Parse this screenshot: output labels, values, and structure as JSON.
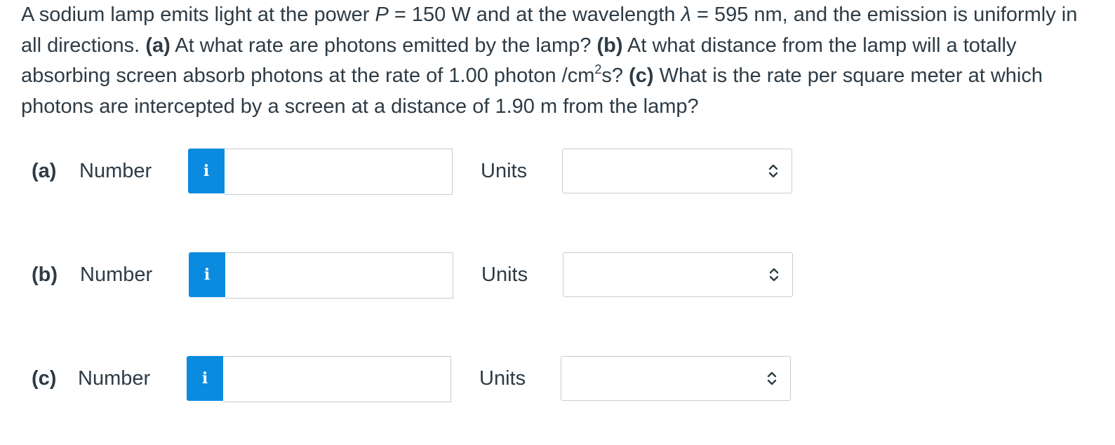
{
  "question": {
    "intro": "A sodium lamp emits light at the power ",
    "P_sym": "P",
    "P_val": " = 150 W and at the wavelength ",
    "lambda_sym": "λ",
    "lambda_val": " = 595 nm, and the emission is uniformly in all directions. ",
    "a_label": "(a)",
    "a_text": " At what rate are photons emitted by the lamp? ",
    "b_label": "(b)",
    "b_text": " At what distance from the lamp will a totally absorbing screen absorb photons at the rate of 1.00 photon /cm",
    "b_sup": "2",
    "b_tail": "s? ",
    "c_label": "(c)",
    "c_text": " What is the rate per square meter at which photons are intercepted by a screen at a distance of 1.90 m from the lamp?"
  },
  "parts": [
    {
      "label": "(a)",
      "number_label": "Number",
      "info": "i",
      "number_value": "",
      "units_label": "Units",
      "units_value": ""
    },
    {
      "label": "(b)",
      "number_label": "Number",
      "info": "i",
      "number_value": "",
      "units_label": "Units",
      "units_value": ""
    },
    {
      "label": "(c)",
      "number_label": "Number",
      "info": "i",
      "number_value": "",
      "units_label": "Units",
      "units_value": ""
    }
  ],
  "colors": {
    "info_button": "#0a8be0",
    "text": "#2d3b45",
    "border": "#c7cdd1"
  },
  "icons": {
    "info": "info-icon",
    "select": "chevron-up-down-icon"
  }
}
